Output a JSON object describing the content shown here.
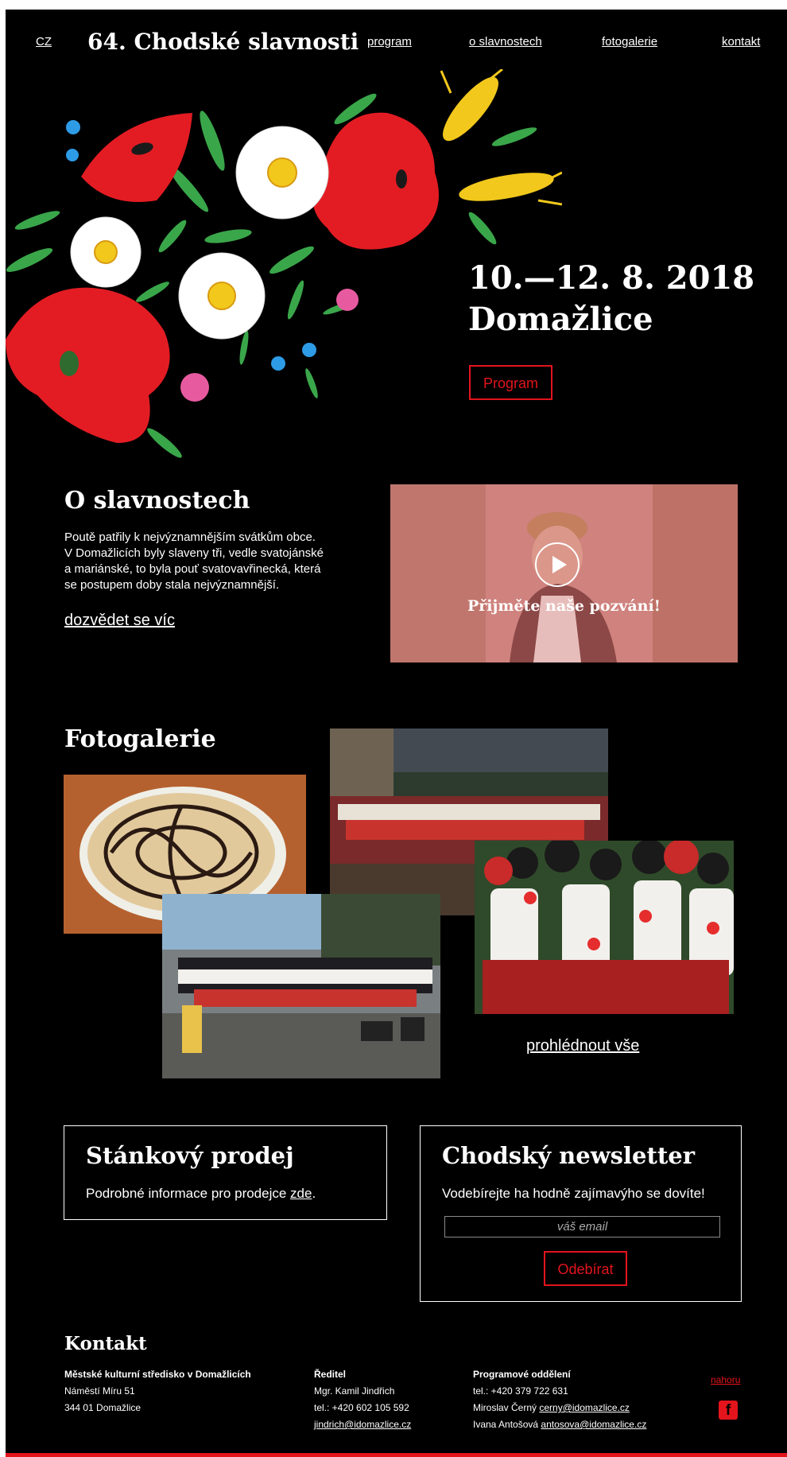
{
  "header": {
    "lang": "CZ",
    "title": "64. Chodské slavnosti",
    "nav": [
      "program",
      "o slavnostech",
      "fotogalerie",
      "kontakt"
    ]
  },
  "hero": {
    "date": "10.—12. 8. 2018",
    "place": "Domažlice",
    "button": "Program"
  },
  "about": {
    "title": "O slavnostech",
    "text_lines": [
      "Poutě patřily k nejvýznamnějším svátkům obce.",
      "V Domažlicích byly slaveny tři, vedle svatojánské",
      "a mariánské, to byla pouť svatovavřinecká, která",
      "se postupem doby stala nejvýznamnější."
    ],
    "more": "dozvědet se víc",
    "video_caption": "Přijměte naše pozvání!"
  },
  "gallery": {
    "title": "Fotogalerie",
    "more": "prohlédnout vše"
  },
  "stall": {
    "title": "Stánkový prodej",
    "text": "Podrobné informace pro prodejce ",
    "link": "zde",
    "end": "."
  },
  "newsletter": {
    "title": "Chodský newsletter",
    "text": "Vodebírejte ha hodně zajímavýho se dovíte!",
    "placeholder": "váš email",
    "button": "Odebírat"
  },
  "footer": {
    "title": "Kontakt",
    "col1": {
      "org": "Městské kulturní středisko v Domažlicích",
      "street": "Náměstí Míru 51",
      "city": "344 01  Domažlice"
    },
    "col2": {
      "role": "Ředitel",
      "name": "Mgr. Kamil Jindřich",
      "phone": "tel.: +420 602 105 592",
      "email": "jindrich@idomazlice.cz"
    },
    "col3": {
      "role": "Programové oddělení",
      "phone": "tel.: +420 379 722 631",
      "p1_name": "Miroslav Černý ",
      "p1_email": "cerny@idomazlice.cz",
      "p2_name": "Ivana Antošová ",
      "p2_email": "antosova@idomazlice.cz"
    },
    "top": "nahoru",
    "fb": "f"
  },
  "colors": {
    "accent": "#e3141c",
    "background": "#000000",
    "text": "#ffffff"
  },
  "icons": [
    "play-icon",
    "facebook-icon"
  ]
}
